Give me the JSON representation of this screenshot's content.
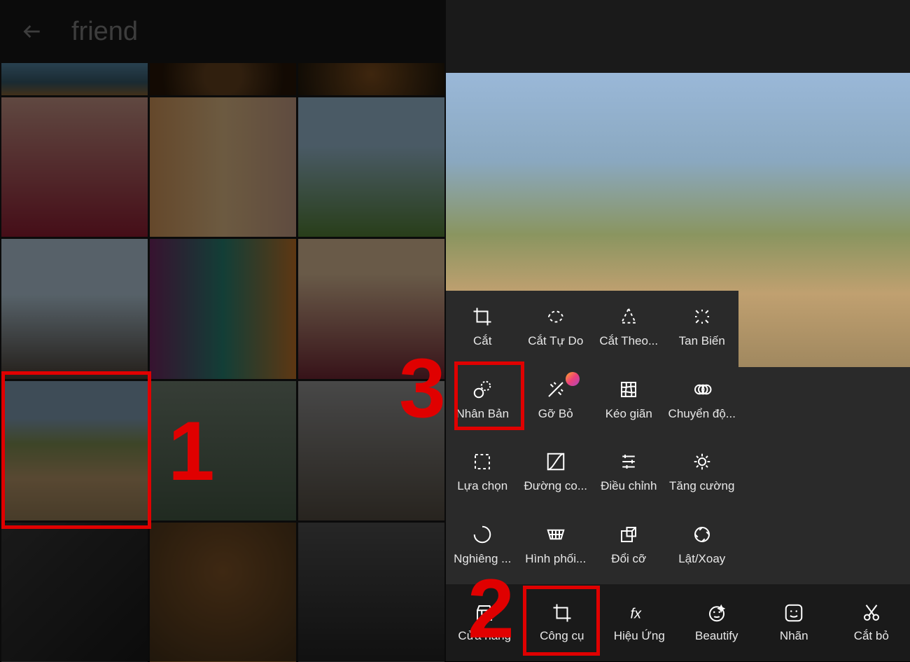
{
  "left": {
    "back_label": "back",
    "search_text": "friend"
  },
  "annotations": {
    "n1": "1",
    "n2": "2",
    "n3": "3"
  },
  "tools": {
    "r1": [
      {
        "label": "Cắt",
        "name": "crop"
      },
      {
        "label": "Cắt Tự Do",
        "name": "free-crop"
      },
      {
        "label": "Cắt Theo...",
        "name": "shape-crop"
      },
      {
        "label": "Tan Biến",
        "name": "dispersion"
      }
    ],
    "r2": [
      {
        "label": "Nhân Bản",
        "name": "clone"
      },
      {
        "label": "Gỡ Bỏ",
        "name": "remove",
        "premium": true
      },
      {
        "label": "Kéo giãn",
        "name": "stretch"
      },
      {
        "label": "Chuyển độ...",
        "name": "motion"
      }
    ],
    "r3": [
      {
        "label": "Lựa chọn",
        "name": "selection"
      },
      {
        "label": "Đường co...",
        "name": "curves"
      },
      {
        "label": "Điều chỉnh",
        "name": "adjust"
      },
      {
        "label": "Tăng cường",
        "name": "enhance"
      }
    ],
    "r4": [
      {
        "label": "Nghiêng ...",
        "name": "tilt-shift"
      },
      {
        "label": "Hình phối...",
        "name": "perspective"
      },
      {
        "label": "Đổi cỡ",
        "name": "resize"
      },
      {
        "label": "Lật/Xoay",
        "name": "flip-rotate"
      }
    ]
  },
  "bottom_bar": [
    {
      "label": "Cửa hàng",
      "name": "store"
    },
    {
      "label": "Công cụ",
      "name": "tools"
    },
    {
      "label": "Hiệu Ứng",
      "name": "effects"
    },
    {
      "label": "Beautify",
      "name": "beautify"
    },
    {
      "label": "Nhãn",
      "name": "sticker"
    },
    {
      "label": "Cắt bỏ",
      "name": "cutout"
    }
  ]
}
